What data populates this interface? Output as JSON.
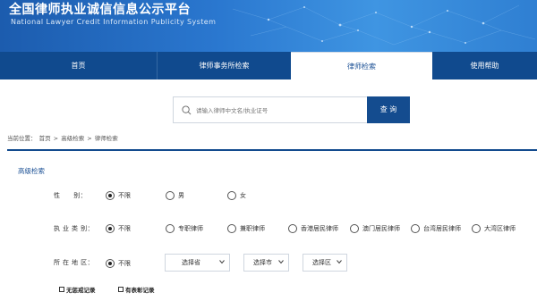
{
  "header": {
    "title": "全国律师执业诚信信息公示平台",
    "subtitle": "National Lawyer Credit Information Publicity System"
  },
  "nav": {
    "items": [
      {
        "label": "首页",
        "active": false
      },
      {
        "label": "律师事务所检索",
        "active": false
      },
      {
        "label": "律师检索",
        "active": true
      },
      {
        "label": "使用帮助",
        "active": false
      }
    ]
  },
  "search": {
    "placeholder": "请输入律师中文名/执业证号",
    "button_label": "查 询",
    "icon": "search-icon"
  },
  "breadcrumb": {
    "prefix": "当前位置：",
    "items": [
      "首页",
      ">",
      "高级检索",
      ">",
      "律师检索"
    ]
  },
  "advanced": {
    "title": "高级检索",
    "gender": {
      "label": "性　　别：",
      "options": [
        "不限",
        "男",
        "女"
      ],
      "selected": "不限"
    },
    "practice_type": {
      "label": "执 业 类 别：",
      "options": [
        "不限",
        "专职律师",
        "兼职律师",
        "香港居民律师",
        "澳门居民律师",
        "台湾居民律师",
        "大湾区律师"
      ],
      "selected": "不限"
    },
    "region": {
      "label": "所 在 地 区：",
      "options": [
        "不限"
      ],
      "selected": "不限",
      "province_select": "选择省",
      "city_select": "选择市",
      "district_select": "选择区"
    },
    "checkboxes": {
      "no_penalty": "无惩戒记录",
      "has_honor": "有表彰记录"
    }
  },
  "colors": {
    "nav_bg": "#104a8e",
    "accent": "#134b8e",
    "banner_start": "#1c5cae",
    "banner_end": "#3f95e2"
  }
}
